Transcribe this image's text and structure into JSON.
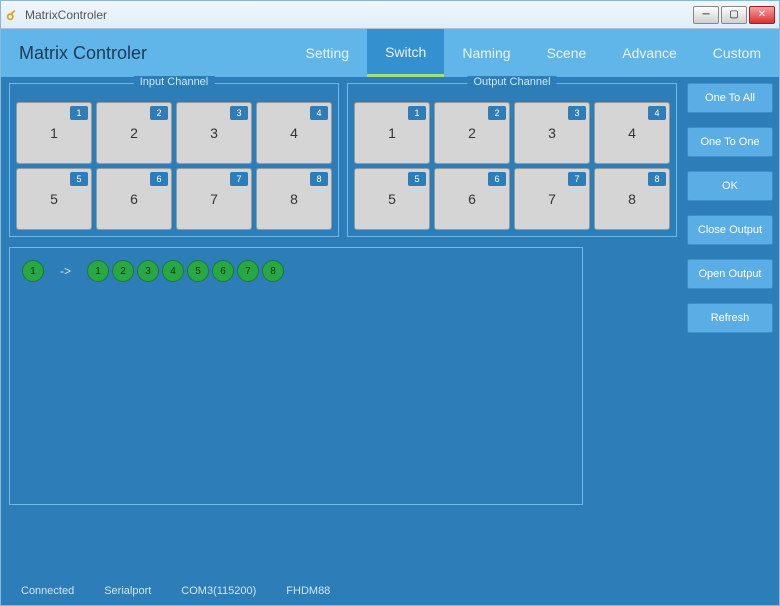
{
  "window": {
    "title": "MatrixControler"
  },
  "header": {
    "app_title": "Matrix Controler",
    "tabs": [
      {
        "label": "Setting",
        "active": false
      },
      {
        "label": "Switch",
        "active": true
      },
      {
        "label": "Naming",
        "active": false
      },
      {
        "label": "Scene",
        "active": false
      },
      {
        "label": "Advance",
        "active": false
      },
      {
        "label": "Custom",
        "active": false
      }
    ]
  },
  "panels": {
    "input": {
      "title": "Input Channel",
      "items": [
        {
          "badge": "1",
          "label": "1"
        },
        {
          "badge": "2",
          "label": "2"
        },
        {
          "badge": "3",
          "label": "3"
        },
        {
          "badge": "4",
          "label": "4"
        },
        {
          "badge": "5",
          "label": "5"
        },
        {
          "badge": "6",
          "label": "6"
        },
        {
          "badge": "7",
          "label": "7"
        },
        {
          "badge": "8",
          "label": "8"
        }
      ]
    },
    "output": {
      "title": "Output Channel",
      "items": [
        {
          "badge": "1",
          "label": "1"
        },
        {
          "badge": "2",
          "label": "2"
        },
        {
          "badge": "3",
          "label": "3"
        },
        {
          "badge": "4",
          "label": "4"
        },
        {
          "badge": "5",
          "label": "5"
        },
        {
          "badge": "6",
          "label": "6"
        },
        {
          "badge": "7",
          "label": "7"
        },
        {
          "badge": "8",
          "label": "8"
        }
      ]
    }
  },
  "side_buttons": {
    "one_to_all": "One To All",
    "one_to_one": "One To One",
    "ok": "OK",
    "close_output": "Close Output",
    "open_output": "Open Output",
    "refresh": "Refresh"
  },
  "routing": {
    "source": "1",
    "arrow": "->",
    "targets": [
      "1",
      "2",
      "3",
      "4",
      "5",
      "6",
      "7",
      "8"
    ]
  },
  "status": {
    "connection": "Connected",
    "port_type": "Serialport",
    "port": "COM3(115200)",
    "device": "FHDM88"
  }
}
